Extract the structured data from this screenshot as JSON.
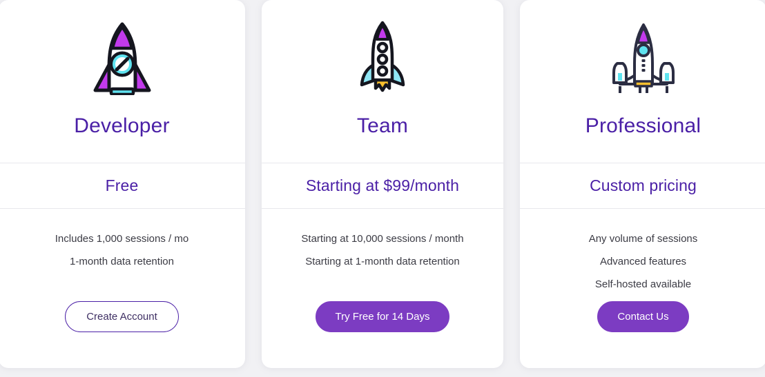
{
  "theme": {
    "page_background": "#f1f1f4",
    "card_background": "#ffffff",
    "heading_purple": "#4a1fa6",
    "button_fill_purple": "#7c3cc2",
    "feature_text": "#3b3b44",
    "divider": "#e7e7ec",
    "icon_magenta": "#c23aec",
    "icon_cyan": "#5fe3f0",
    "icon_yellow": "#f9bf2e",
    "icon_outline": "#15161f"
  },
  "plans": [
    {
      "id": "developer",
      "icon_name": "rocket-classic-icon",
      "name": "Developer",
      "price": "Free",
      "features": [
        "Includes 1,000 sessions / mo",
        "1-month data retention"
      ],
      "cta_label": "Create Account",
      "cta_style": "outline"
    },
    {
      "id": "team",
      "icon_name": "rocket-launching-icon",
      "name": "Team",
      "price": "Starting at $99/month",
      "features": [
        "Starting at 10,000 sessions / month",
        "Starting at 1-month data retention"
      ],
      "cta_label": "Try Free for 14 Days",
      "cta_style": "filled"
    },
    {
      "id": "professional",
      "icon_name": "space-shuttle-icon",
      "name": "Professional",
      "price": "Custom pricing",
      "features": [
        "Any volume of sessions",
        "Advanced features",
        "Self-hosted available"
      ],
      "cta_label": "Contact Us",
      "cta_style": "filled"
    }
  ]
}
